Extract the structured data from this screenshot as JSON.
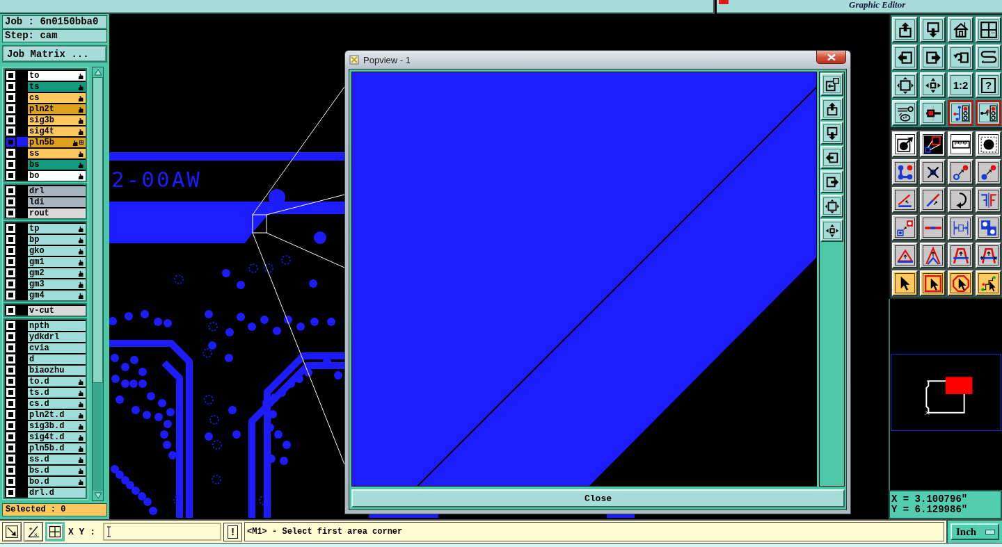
{
  "top_bar": {
    "product": "Graphic Editor"
  },
  "job": {
    "job": "Job : 6n0150bba0",
    "step": "Step: cam",
    "matrix_button": "Job Matrix ..."
  },
  "layer_groups": [
    {
      "layers": [
        {
          "name": "to",
          "color": "#ffffff",
          "hand": true,
          "checked": false,
          "selected": false
        },
        {
          "name": "ts",
          "color": "#139a7c",
          "hand": true,
          "checked": false,
          "selected": false
        },
        {
          "name": "cs",
          "color": "#fdc95e",
          "hand": true,
          "checked": false,
          "selected": false
        },
        {
          "name": "pln2t",
          "color": "#dea21e",
          "hand": true,
          "checked": false,
          "selected": false
        },
        {
          "name": "sig3b",
          "color": "#fdc95e",
          "hand": true,
          "checked": false,
          "selected": false
        },
        {
          "name": "sig4t",
          "color": "#fdc95e",
          "hand": true,
          "checked": false,
          "selected": false
        },
        {
          "name": "pln5b",
          "color": "#dea21e",
          "hand": true,
          "checked": false,
          "selected": true
        },
        {
          "name": "ss",
          "color": "#fdc95e",
          "hand": true,
          "checked": false,
          "selected": false
        },
        {
          "name": "bs",
          "color": "#139a7c",
          "hand": true,
          "checked": false,
          "selected": false
        },
        {
          "name": "bo",
          "color": "#ffffff",
          "hand": true,
          "checked": false,
          "selected": false
        }
      ]
    },
    {
      "layers": [
        {
          "name": "drl",
          "color": "#a7b6be",
          "hand": false,
          "checked": false,
          "selected": false
        },
        {
          "name": "ldi",
          "color": "#a7b6be",
          "hand": false,
          "checked": false,
          "selected": false
        },
        {
          "name": "rout",
          "color": "#d9d9d9",
          "hand": false,
          "checked": false,
          "selected": false
        }
      ]
    },
    {
      "layers": [
        {
          "name": "tp",
          "color": "#a0dcd8",
          "hand": true,
          "checked": false,
          "selected": false
        },
        {
          "name": "bp",
          "color": "#a0dcd8",
          "hand": true,
          "checked": false,
          "selected": false
        },
        {
          "name": "gko",
          "color": "#a0dcd8",
          "hand": true,
          "checked": false,
          "selected": false
        },
        {
          "name": "gm1",
          "color": "#a0dcd8",
          "hand": true,
          "checked": false,
          "selected": false
        },
        {
          "name": "gm2",
          "color": "#a0dcd8",
          "hand": true,
          "checked": false,
          "selected": false
        },
        {
          "name": "gm3",
          "color": "#a0dcd8",
          "hand": true,
          "checked": false,
          "selected": false
        },
        {
          "name": "gm4",
          "color": "#a0dcd8",
          "hand": true,
          "checked": false,
          "selected": false
        }
      ]
    },
    {
      "layers": [
        {
          "name": "v-cut",
          "color": "#d9d9d9",
          "hand": false,
          "checked": false,
          "selected": false
        }
      ]
    },
    {
      "layers": [
        {
          "name": "npth",
          "color": "#a0dcd8",
          "hand": false,
          "checked": false,
          "selected": false
        },
        {
          "name": "ydkdrl",
          "color": "#a0dcd8",
          "hand": false,
          "checked": false,
          "selected": false
        },
        {
          "name": "cvia",
          "color": "#a0dcd8",
          "hand": false,
          "checked": false,
          "selected": false
        },
        {
          "name": "d",
          "color": "#a0dcd8",
          "hand": false,
          "checked": false,
          "selected": false
        },
        {
          "name": "biaozhu",
          "color": "#a0dcd8",
          "hand": false,
          "checked": false,
          "selected": false
        },
        {
          "name": "to.d",
          "color": "#a0dcd8",
          "hand": true,
          "checked": false,
          "selected": false
        },
        {
          "name": "ts.d",
          "color": "#a0dcd8",
          "hand": true,
          "checked": false,
          "selected": false
        },
        {
          "name": "cs.d",
          "color": "#a0dcd8",
          "hand": true,
          "checked": false,
          "selected": false
        },
        {
          "name": "pln2t.d",
          "color": "#a0dcd8",
          "hand": true,
          "checked": false,
          "selected": false
        },
        {
          "name": "sig3b.d",
          "color": "#a0dcd8",
          "hand": true,
          "checked": false,
          "selected": false
        },
        {
          "name": "sig4t.d",
          "color": "#a0dcd8",
          "hand": true,
          "checked": false,
          "selected": false
        },
        {
          "name": "pln5b.d",
          "color": "#a0dcd8",
          "hand": true,
          "checked": false,
          "selected": false
        },
        {
          "name": "ss.d",
          "color": "#a0dcd8",
          "hand": true,
          "checked": false,
          "selected": false
        },
        {
          "name": "bs.d",
          "color": "#a0dcd8",
          "hand": true,
          "checked": false,
          "selected": false
        },
        {
          "name": "bo.d",
          "color": "#a0dcd8",
          "hand": true,
          "checked": false,
          "selected": false
        },
        {
          "name": "drl.d",
          "color": "#a0dcd8",
          "hand": false,
          "checked": false,
          "selected": false
        }
      ]
    }
  ],
  "selected_count": "Selected : 0",
  "canvas": {
    "board_text": "2-00AW"
  },
  "popview": {
    "title": "Popview - 1",
    "close_button": "Close"
  },
  "toolbar_groups": [
    {
      "buttons": [
        {
          "kind": "view",
          "active": false
        },
        {
          "kind": "view",
          "active": false
        },
        {
          "kind": "view",
          "active": false
        },
        {
          "kind": "view",
          "active": false
        },
        {
          "kind": "view",
          "active": false
        },
        {
          "kind": "view",
          "active": false
        },
        {
          "kind": "view",
          "active": false
        },
        {
          "kind": "view",
          "active": false
        },
        {
          "kind": "view",
          "active": false
        },
        {
          "kind": "view",
          "active": false
        },
        {
          "kind": "view",
          "active": false,
          "label": "1:2"
        },
        {
          "kind": "view",
          "active": false,
          "label": "?"
        },
        {
          "kind": "view",
          "active": false
        },
        {
          "kind": "view",
          "active": false
        },
        {
          "kind": "view",
          "active": true
        },
        {
          "kind": "view",
          "active": true
        }
      ]
    },
    {
      "buttons": [
        {
          "kind": "display",
          "active": false
        },
        {
          "kind": "display",
          "active": false
        },
        {
          "kind": "display",
          "active": false
        },
        {
          "kind": "display",
          "active": false
        },
        {
          "kind": "edit",
          "active": false
        },
        {
          "kind": "edit",
          "active": false
        },
        {
          "kind": "edit",
          "active": false
        },
        {
          "kind": "edit",
          "active": false
        },
        {
          "kind": "edit",
          "active": false
        },
        {
          "kind": "edit",
          "active": false
        },
        {
          "kind": "edit",
          "active": false
        },
        {
          "kind": "edit",
          "active": false
        },
        {
          "kind": "edit",
          "active": false
        },
        {
          "kind": "edit",
          "active": false
        },
        {
          "kind": "edit",
          "active": false
        },
        {
          "kind": "edit",
          "active": false
        },
        {
          "kind": "edit",
          "active": false
        },
        {
          "kind": "edit",
          "active": false
        },
        {
          "kind": "edit",
          "active": false
        },
        {
          "kind": "edit",
          "active": false
        },
        {
          "kind": "select",
          "active": false
        },
        {
          "kind": "select",
          "active": false
        },
        {
          "kind": "select",
          "active": false
        },
        {
          "kind": "select",
          "active": false
        }
      ]
    }
  ],
  "coordinates": {
    "x": "X = 3.100796\"",
    "y": "Y = 6.129986\""
  },
  "command_bar": {
    "tools": [
      {
        "active": false
      },
      {
        "active": false
      },
      {
        "active": true
      }
    ],
    "xy_label": "X Y :",
    "alert_button": "!",
    "prompt": "<M1> - Select first area corner",
    "units": "Inch"
  }
}
